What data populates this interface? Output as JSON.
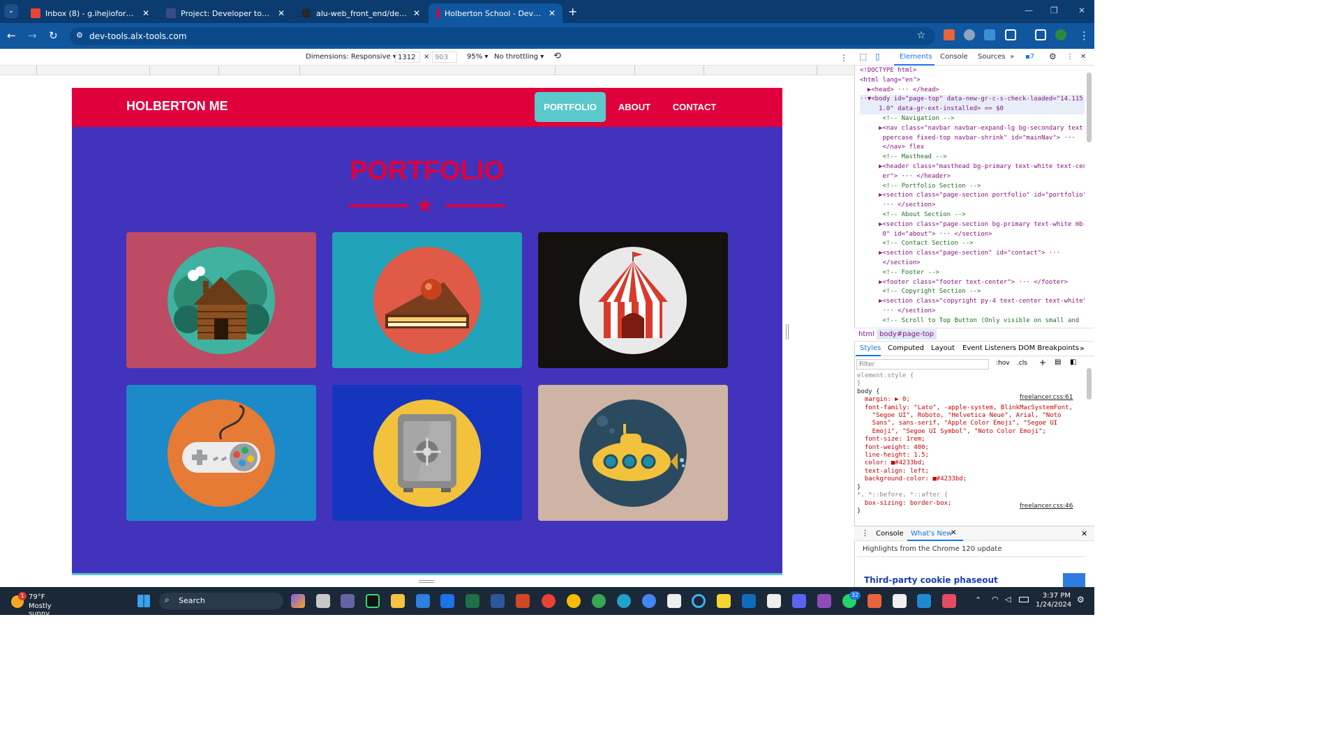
{
  "tabs": [
    {
      "title": "Inbox (8) - g.ihejiofor@alustude",
      "favicon_color": "#ea4335"
    },
    {
      "title": "Project: Developer tools | ALU In",
      "favicon_color": "#3b4a8a"
    },
    {
      "title": "alu-web_front_end/developer_t",
      "favicon_color": "#24292f"
    },
    {
      "title": "Holberton School - Developer t",
      "favicon_color": "#e0003c"
    }
  ],
  "address": {
    "url": "dev-tools.alx-tools.com"
  },
  "emulation": {
    "dimensions_label": "Dimensions: Responsive ▾",
    "width": "1312",
    "x": "×",
    "height": "903",
    "zoom": "95% ▾",
    "throttling": "No throttling ▾"
  },
  "site": {
    "brand": "HOLBERTON ME",
    "nav": [
      "PORTFOLIO",
      "ABOUT",
      "CONTACT"
    ],
    "section_title": "PORTFOLIO",
    "star": "★",
    "cards": [
      {
        "name": "cabin",
        "bg": "#bc4b63",
        "circle": "#3fb39f"
      },
      {
        "name": "cake",
        "bg": "#20a3b8",
        "circle": "#df5a47"
      },
      {
        "name": "circus",
        "bg": "#14110f",
        "circle": "#e9e9e9"
      },
      {
        "name": "game",
        "bg": "#1c89c9",
        "circle": "#e67b36"
      },
      {
        "name": "safe",
        "bg": "#1436be",
        "circle": "#f2c23c"
      },
      {
        "name": "submarine",
        "bg": "#ceb4a5",
        "circle": "#2c4a5f"
      }
    ]
  },
  "devtools": {
    "tabs": [
      "Elements",
      "Console",
      "Sources"
    ],
    "issues": "7",
    "dom_lines": [
      [
        "",
        "<!DOCTYPE html>"
      ],
      [
        "",
        "<html lang=\"en\">"
      ],
      [
        "",
        "  ▶<head> ··· </head>"
      ],
      [
        "",
        "··▼<body id=\"page-top\" data-new-gr-c-s-check-loaded=\"14.115"
      ],
      [
        "",
        "     1.0\" data-gr-ext-installed> == $0"
      ],
      [
        "c",
        "      <!-- Navigation -->"
      ],
      [
        "",
        "     ▶<nav class=\"navbar navbar-expand-lg bg-secondary text-u"
      ],
      [
        "",
        "      ppercase fixed-top navbar-shrink\" id=\"mainNav\"> ···"
      ],
      [
        "",
        "      </nav> flex"
      ],
      [
        "c",
        "      <!-- Masthead -->"
      ],
      [
        "",
        "     ▶<header class=\"masthead bg-primary text-white text-cent"
      ],
      [
        "",
        "      er\"> ··· </header>"
      ],
      [
        "c",
        "      <!-- Portfolio Section -->"
      ],
      [
        "",
        "     ▶<section class=\"page-section portfolio\" id=\"portfolio\">"
      ],
      [
        "",
        "      ··· </section>"
      ],
      [
        "c",
        "      <!-- About Section -->"
      ],
      [
        "",
        "     ▶<section class=\"page-section bg-primary text-white mb-"
      ],
      [
        "",
        "      0\" id=\"about\"> ··· </section>"
      ],
      [
        "c",
        "      <!-- Contact Section -->"
      ],
      [
        "",
        "     ▶<section class=\"page-section\" id=\"contact\"> ···"
      ],
      [
        "",
        "      </section>"
      ],
      [
        "c",
        "      <!-- Footer -->"
      ],
      [
        "",
        "     ▶<footer class=\"footer text-center\"> ··· </footer>"
      ],
      [
        "c",
        "      <!-- Copyright Section -->"
      ],
      [
        "",
        "     ▶<section class=\"copyright py-4 text-center text-white\">"
      ],
      [
        "",
        "      ··· </section>"
      ],
      [
        "c",
        "      <!-- Scroll to Top Button (Only visible on small and"
      ]
    ],
    "breadcrumb": [
      "html",
      "body#page-top"
    ],
    "style_tabs": [
      "Styles",
      "Computed",
      "Layout",
      "Event Listeners",
      "DOM Breakpoints"
    ],
    "filter_placeholder": "Filter",
    "hov": ":hov",
    "cls": ".cls",
    "css_lines": [
      "element.style {",
      "}",
      "body {",
      "  margin: ▶ 0;",
      "  font-family: \"Lato\", -apple-system, BlinkMacSystemFont,",
      "    \"Segoe UI\", Roboto, \"Helvetica Neue\", Arial, \"Noto",
      "    Sans\", sans-serif, \"Apple Color Emoji\", \"Segoe UI",
      "    Emoji\", \"Segoe UI Symbol\", \"Noto Color Emoji\";",
      "  font-size: 1rem;",
      "  font-weight: 400;",
      "  line-height: 1.5;",
      "  color: ■#4233bd;",
      "  text-align: left;",
      "  background-color: ■#4233bd;",
      "}",
      "*, *::before, *::after {",
      "  box-sizing: border-box;",
      "}"
    ],
    "css_sources": [
      "freelancer.css:61",
      "freelancer.css:46"
    ],
    "drawer_tabs": [
      "Console",
      "What's New"
    ],
    "drawer_highlight": "Highlights from the Chrome 120 update",
    "drawer_heading": "Third-party cookie phaseout"
  },
  "taskbar": {
    "weather_temp": "79°F",
    "weather_text": "Mostly sunny",
    "weather_badge": "1",
    "search": "Search",
    "time": "3:37 PM",
    "date": "1/24/2024",
    "wa_badge": "32"
  }
}
